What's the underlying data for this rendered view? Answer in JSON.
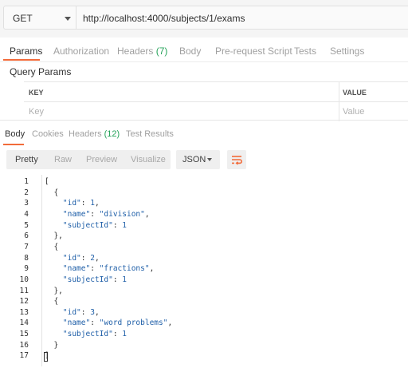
{
  "request": {
    "method": "GET",
    "url": "http://localhost:4000/subjects/1/exams"
  },
  "request_tabs": [
    {
      "label": "Params",
      "count": ""
    },
    {
      "label": "Authorization",
      "count": ""
    },
    {
      "label": "Headers",
      "count": "(7)"
    },
    {
      "label": "Body",
      "count": ""
    },
    {
      "label": "Pre-request Script",
      "count": ""
    },
    {
      "label": "Tests",
      "count": ""
    },
    {
      "label": "Settings",
      "count": ""
    }
  ],
  "query_params": {
    "title": "Query Params",
    "key_header": "KEY",
    "value_header": "VALUE",
    "key_placeholder": "Key",
    "value_placeholder": "Value"
  },
  "response_tabs": [
    {
      "label": "Body",
      "count": ""
    },
    {
      "label": "Cookies",
      "count": ""
    },
    {
      "label": "Headers",
      "count": "(12)"
    },
    {
      "label": "Test Results",
      "count": ""
    }
  ],
  "view_modes": [
    "Pretty",
    "Raw",
    "Preview",
    "Visualize"
  ],
  "format": "JSON",
  "colors": {
    "accent": "#f26b3a",
    "count_green": "#26a35a",
    "json_value": "#1f5fa8"
  },
  "code_lines": [
    "[",
    "  {",
    "    \"id\": 1,",
    "    \"name\": \"division\",",
    "    \"subjectId\": 1",
    "  },",
    "  {",
    "    \"id\": 2,",
    "    \"name\": \"fractions\",",
    "    \"subjectId\": 1",
    "  },",
    "  {",
    "    \"id\": 3,",
    "    \"name\": \"word problems\",",
    "    \"subjectId\": 1",
    "  }",
    "]"
  ]
}
